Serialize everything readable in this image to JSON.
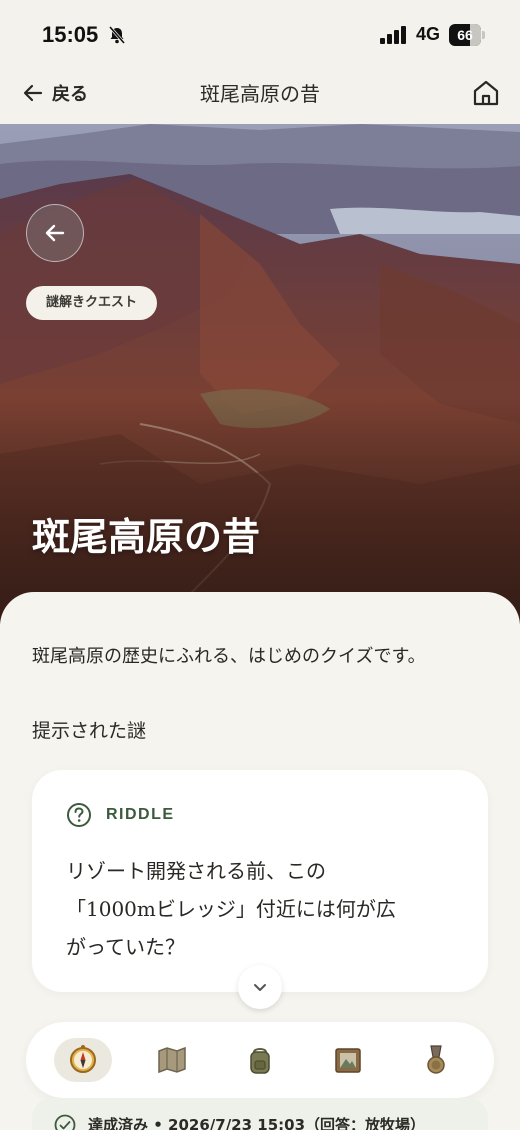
{
  "status_bar": {
    "time": "15:05",
    "network": "4G",
    "battery": "66",
    "battery_level": 0.66
  },
  "header": {
    "back_label": "戻る",
    "title": "斑尾高原の昔"
  },
  "hero": {
    "badge": "謎解きクエスト",
    "title": "斑尾高原の昔"
  },
  "content": {
    "intro": "斑尾高原の歴史にふれる、はじめのクイズです。",
    "section_heading": "提示された謎"
  },
  "riddle": {
    "label": "RIDDLE",
    "lines": [
      "リゾート開発される前、この",
      "「1000mビレッジ」付近には何が広",
      "がっていた？"
    ]
  },
  "tabs": [
    {
      "icon": "compass-icon",
      "active": true
    },
    {
      "icon": "map-icon",
      "active": false
    },
    {
      "icon": "backpack-icon",
      "active": false
    },
    {
      "icon": "picture-frame-icon",
      "active": false
    },
    {
      "icon": "medal-icon",
      "active": false
    }
  ],
  "completion": {
    "text": "達成済み • 2026/7/23 15:03（回答：放牧場）"
  },
  "colors": {
    "accent_green": "#3c5a3c",
    "background": "#f4f2ec"
  }
}
